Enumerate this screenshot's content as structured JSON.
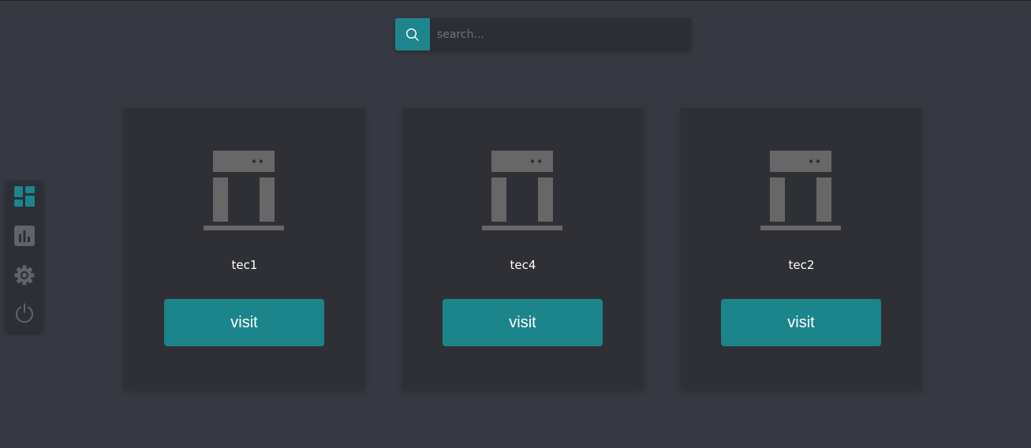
{
  "search": {
    "placeholder": "search...",
    "value": "",
    "icon": "search-icon"
  },
  "sidebar": {
    "items": [
      {
        "name": "dashboard",
        "icon": "dashboard-icon",
        "active": true
      },
      {
        "name": "stats",
        "icon": "bar-chart-icon",
        "active": false
      },
      {
        "name": "settings",
        "icon": "gear-icon",
        "active": false
      },
      {
        "name": "logout",
        "icon": "power-icon",
        "active": false
      }
    ]
  },
  "cards": [
    {
      "name": "tec1",
      "icon": "gate-icon",
      "button_label": "visit"
    },
    {
      "name": "tec4",
      "icon": "gate-icon",
      "button_label": "visit"
    },
    {
      "name": "tec2",
      "icon": "gate-icon",
      "button_label": "visit"
    }
  ],
  "colors": {
    "background": "#363942",
    "card": "#2e3036",
    "accent": "#1c848b",
    "icon_gray": "#676767",
    "sidebar_inactive": "#5f636a"
  }
}
